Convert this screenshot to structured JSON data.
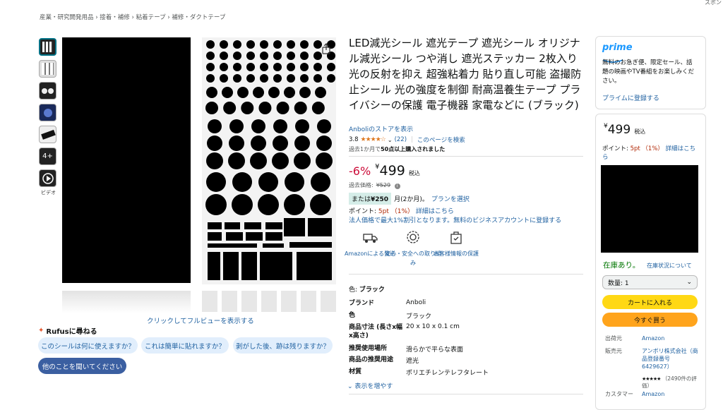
{
  "sponsor": "スポン",
  "breadcrumb": "産業・研究開発用品 › 接着・補修 › 粘着テープ › 補修・ダクトテープ",
  "gallery": {
    "video_label": "ビデオ",
    "fullview_link": "クリックしてフルビューを表示する",
    "thumb4_text": "4+"
  },
  "rufus": {
    "title": "Rufusに尋ねる",
    "questions": [
      "このシールは何に使えますか？",
      "これは簡単に貼れますか？",
      "剥がした後、跡は残りますか？"
    ],
    "ask_other": "他のことを聞いてください"
  },
  "product": {
    "title": "LED減光シール 遮光テープ 遮光シール オリジナル減光シール つや消し 遮光ステッカー 2枚入り 光の反射を抑え 超強粘着力 貼り直し可能 盗撮防止シール 光の強度を制御 耐高温養生テープ プライバシーの保護 電子機器 家電などに (ブラック)",
    "store_link": "Anboliのストアを表示",
    "rating": "3.8",
    "stars": "★★★★☆",
    "review_count": "(22)",
    "search_page": "このページを検索",
    "bought_prefix": "過去1か月で",
    "bought_bold": "50点以上購入されました",
    "discount": "-6%",
    "price_symbol": "¥",
    "price": "499",
    "tax": "税込",
    "past_price_label": "過去価格:",
    "past_price": "¥529",
    "installment_badge_prefix": "または",
    "installment_badge_amount": "¥250",
    "installment_period": "月(2か月)。",
    "installment_link": "プランを選択",
    "points_label": "ポイント: ",
    "points_value": "5pt （1%）",
    "points_link": "詳細はこちら",
    "business": "法人価格で最大1%割引となります。無料のビジネスアカウントに登録する"
  },
  "features": [
    {
      "icon": "truck-icon",
      "label": "Amazonによる発送"
    },
    {
      "icon": "safety-gear-icon",
      "label": "安心・安全への取り組み"
    },
    {
      "icon": "secure-bag-icon",
      "label": "お客様情報の保護"
    }
  ],
  "color": {
    "label": "色:",
    "value": "ブラック"
  },
  "specs": [
    {
      "key": "ブランド",
      "value": "Anboli"
    },
    {
      "key": "色",
      "value": "ブラック"
    },
    {
      "key": "商品寸法 (長さx幅x高さ)",
      "value": "20 x 10 x 0.1 cm"
    },
    {
      "key": "推奨使用場所",
      "value": "滑らかで平らな表面"
    },
    {
      "key": "商品の推奨用途",
      "value": "遮光"
    },
    {
      "key": "材質",
      "value": "ポリエチレンテレフタレート"
    }
  ],
  "more_link": "表示を増やす",
  "prime": {
    "logo": "prime",
    "text": "無料のお急ぎ便、限定セール、話題の映画やTV番組をお楽しみください。",
    "link": "プライムに登録する"
  },
  "buybox": {
    "price_symbol": "¥",
    "price": "499",
    "tax": "税込",
    "points_label": "ポイント: ",
    "points_value": "5pt （1%）",
    "points_link": "詳細はこちら",
    "stock": "在庫あり。",
    "stock_link": "在庫状況について",
    "qty": "数量: 1",
    "cart": "カートに入れる",
    "buy_now": "今すぐ買う",
    "shipper_label": "出荷元",
    "shipper": "Amazon",
    "seller_label": "販売元",
    "seller": "アンボリ株式会社（商品登録番号 6429627）",
    "seller_stars": "★★★★★",
    "seller_reviews": "（2490件の評価）",
    "cs_label": "カスタマー",
    "cs_value": "Amazon"
  },
  "colors": {
    "link": "#2162a1",
    "price_red": "#cc0c39",
    "cart_yellow": "#ffd814",
    "buy_orange": "#ffa41c",
    "stock_green": "#007600"
  }
}
